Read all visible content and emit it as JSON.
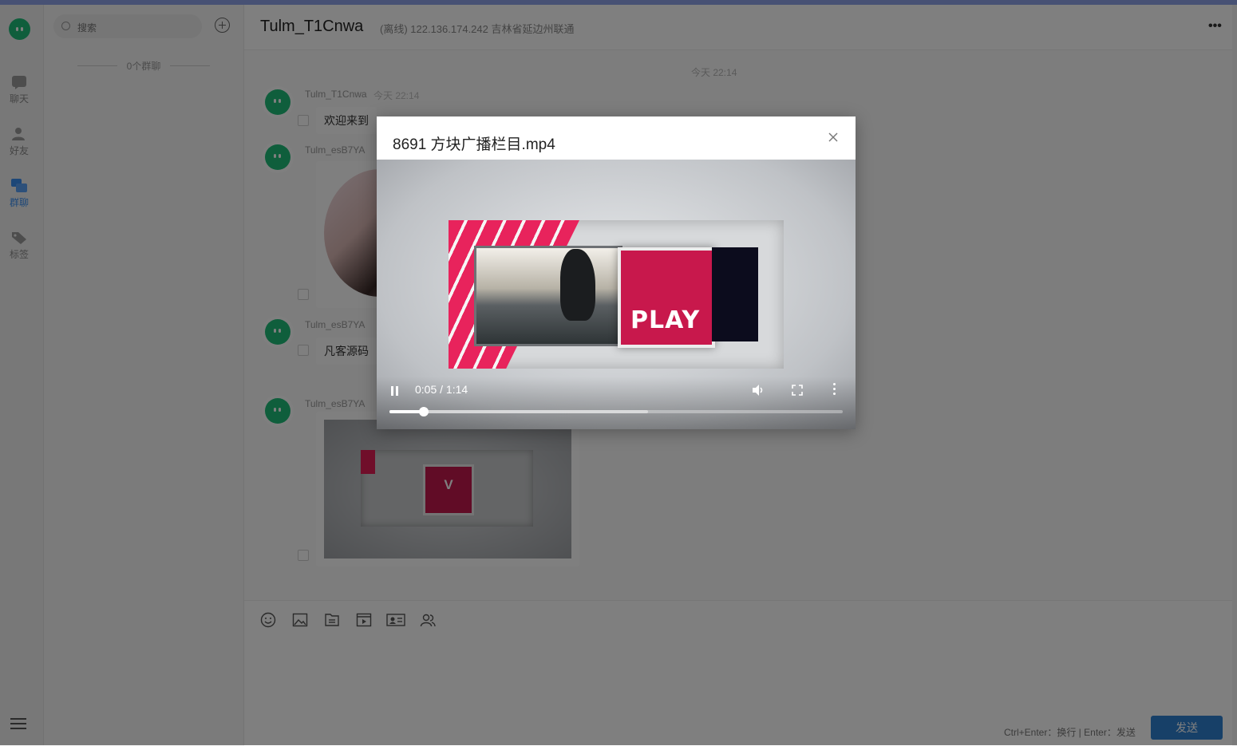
{
  "nav": {
    "items": [
      {
        "label": "聊天",
        "icon": "chat-icon"
      },
      {
        "label": "好友",
        "icon": "friends-icon"
      },
      {
        "label": "群聊",
        "icon": "group-chat-icon",
        "active": true
      },
      {
        "label": "标签",
        "icon": "tag-icon"
      }
    ],
    "active_color": "#3b8ef0"
  },
  "group_list": {
    "search_placeholder": "搜索",
    "group_count": "0个群聊"
  },
  "chat": {
    "title": "Tulm_T1Cnwa",
    "status": "(离线) 122.136.174.242 吉林省延边州联通",
    "time_divider": "今天 22:14",
    "messages": [
      {
        "sender": "Tulm_T1Cnwa",
        "time": "今天 22:14",
        "type": "text",
        "text": "欢迎来到"
      },
      {
        "sender": "Tulm_esB7YA",
        "type": "image"
      },
      {
        "sender": "Tulm_esB7YA",
        "type": "text",
        "text": "凡客源码"
      },
      {
        "sender": "Tulm_esB7YA",
        "type": "video"
      }
    ]
  },
  "composer": {
    "tools": [
      "emoji-icon",
      "image-icon",
      "file-icon",
      "video-icon",
      "card-icon",
      "contacts-icon"
    ],
    "hint": "Ctrl+Enter：换行 | Enter：发送",
    "send_label": "发送",
    "send_color": "#2f80d1"
  },
  "video_modal": {
    "title": "8691 方块广播栏目.mp4",
    "play_label": "PLAY",
    "time_display": "0:05 / 1:14",
    "progress": 0.076,
    "buffered": 0.57
  },
  "thumb_logo": "V"
}
